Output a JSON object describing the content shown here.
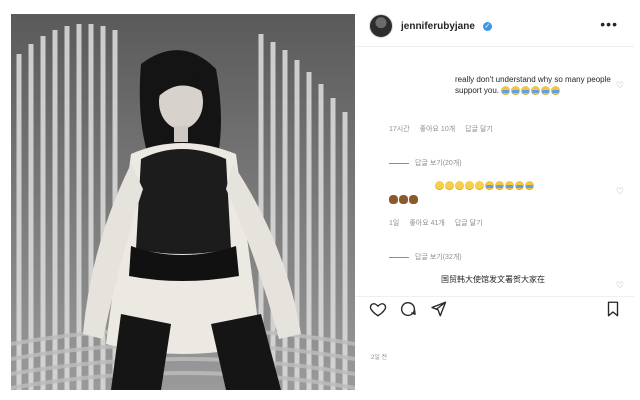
{
  "post": {
    "username": "jenniferubyjane",
    "more_label": "•••",
    "posted_time": "2일 전"
  },
  "comments": [
    {
      "text": "really don't understand why so many people support you.",
      "emojis": [
        "cry",
        "cry",
        "cry",
        "cry",
        "cry",
        "cry"
      ],
      "time": "17시간",
      "likes": "좋아요 10개",
      "reply": "답글 달기",
      "view_replies": "답글 보기(20개)"
    },
    {
      "text": "",
      "emojis_line1": [
        "laugh",
        "laugh",
        "laugh",
        "laugh",
        "laugh",
        "cry",
        "cry",
        "cry",
        "cry",
        "cry"
      ],
      "emojis_line2": [
        "poop",
        "poop",
        "poop"
      ],
      "time": "1일",
      "likes": "좋아요 41개",
      "reply": "답글 달기",
      "view_replies": "답글 보기(32개)"
    },
    {
      "text": "国贸韩大使馆发文署贺大家在"
    }
  ],
  "colors": {
    "verified": "#3897f0",
    "muted": "#8e8e8e"
  }
}
